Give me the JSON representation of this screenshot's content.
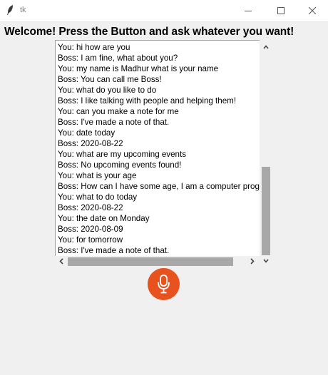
{
  "window": {
    "title": "tk"
  },
  "heading": "Welcome! Press the Button and ask whatever you want!",
  "chat": {
    "lines": [
      "You: hi how are you",
      "Boss: I am fine, what about you?",
      "You: my name is Madhur what is your name",
      "Boss: You can call me Boss!",
      "You: what do you like to do",
      "Boss: I like talking with people and helping them!",
      "You: can you make a note for me",
      "Boss: I've made a note of that.",
      "You: date today",
      "Boss: 2020-08-22",
      "You: what are my upcoming events",
      "Boss: No upcoming events found!",
      "You: what is your age",
      "Boss: How can I have some age, I am a computer program",
      "You: what to do today",
      "Boss: 2020-08-22",
      "You: the date on Monday",
      "Boss: 2020-08-09",
      "You: for tomorrow",
      "Boss: I've made a note of that."
    ]
  },
  "icons": {
    "app": "feather-icon",
    "minimize": "minimize-icon",
    "maximize": "maximize-icon",
    "close": "close-icon",
    "mic": "microphone-icon"
  },
  "colors": {
    "mic_button": "#e8521f",
    "scrollbar_thumb": "#a8a8a8",
    "background": "#f0f0f0"
  }
}
